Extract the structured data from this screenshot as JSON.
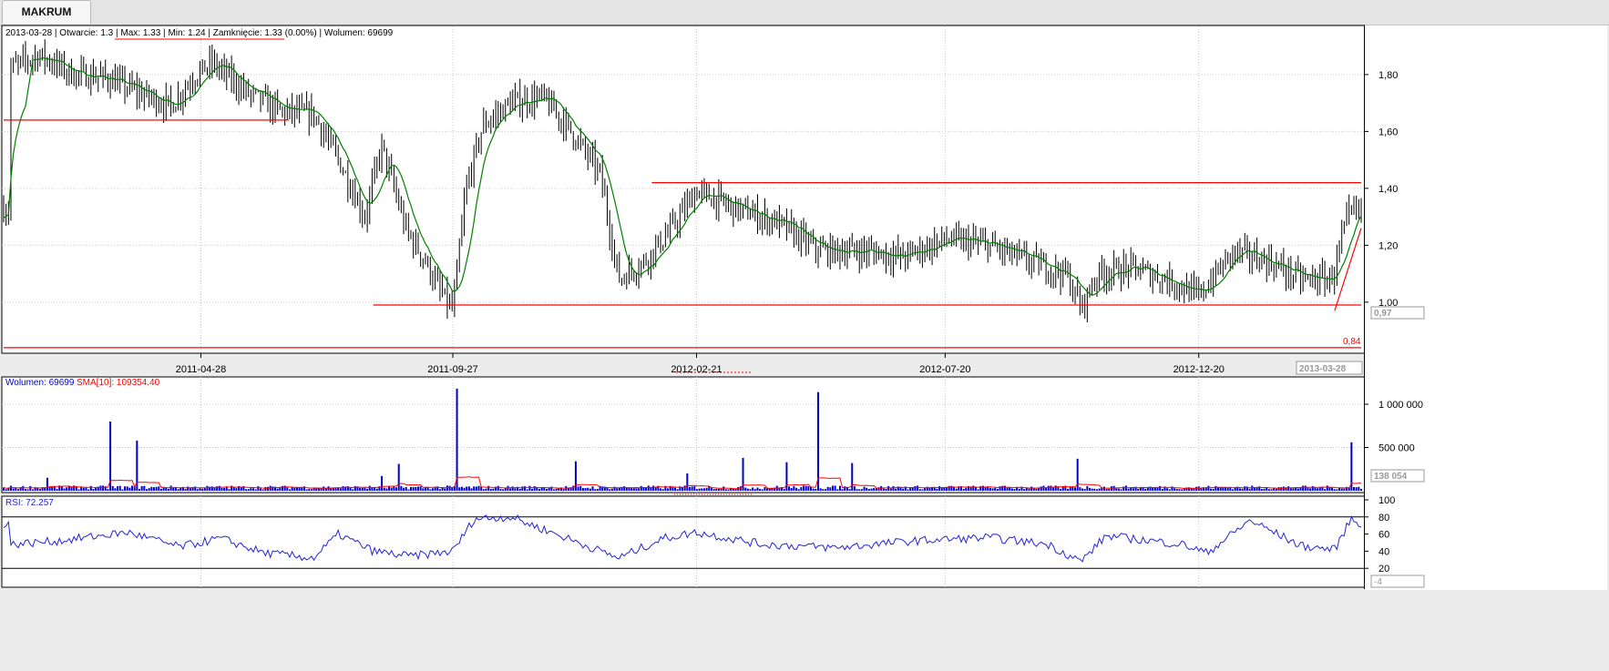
{
  "app": {
    "tab_label": "MAKRUM"
  },
  "colors": {
    "price_bars": "#000000",
    "moving_average": "#008000",
    "trendlines": "#ff0000",
    "volume": "#0000cc",
    "volume_sma": "#ff0000",
    "rsi": "#2222dd",
    "grid": "#c8c8c8",
    "panel_bg": "#ffffff"
  },
  "price_panel": {
    "info_line": "2013-03-28 | Otwarcie: 1.3 | Max: 1.33 | Min: 1.24 | Zamknięcie: 1.33 (0.00%)  | Wolumen: 69699",
    "min_label": "0,84",
    "last_value_badge": "0,97",
    "date_badge": "2013-03-28"
  },
  "volume_panel": {
    "legend_volume": "Wolumen: 69699",
    "legend_sma": "SMA[10]: 109354.40",
    "last_value_badge": "138 054"
  },
  "rsi_panel": {
    "legend": "RSI: 72.257",
    "last_value_badge": "-4"
  },
  "chart_data": [
    {
      "type": "candlestick-ohlc",
      "title": "",
      "x_tick_labels": [
        "2011-04-28",
        "2011-09-27",
        "2012-02-21",
        "2012-07-20",
        "2012-12-20"
      ],
      "x_range": [
        "2010-12-30",
        "2013-03-28"
      ],
      "y_ticks": [
        1.0,
        1.2,
        1.4,
        1.6,
        1.8
      ],
      "y_tick_labels": [
        "1,00",
        "1,20",
        "1,40",
        "1,60",
        "1,80"
      ],
      "ylim": [
        0.83,
        1.95
      ],
      "grid": true,
      "series_close_approx": [
        [
          "2011-01-03",
          1.82
        ],
        [
          "2011-01-20",
          1.87
        ],
        [
          "2011-02-10",
          1.8
        ],
        [
          "2011-03-01",
          1.79
        ],
        [
          "2011-03-20",
          1.74
        ],
        [
          "2011-04-10",
          1.69
        ],
        [
          "2011-04-25",
          1.8
        ],
        [
          "2011-05-05",
          1.84
        ],
        [
          "2011-05-25",
          1.74
        ],
        [
          "2011-06-15",
          1.67
        ],
        [
          "2011-07-05",
          1.66
        ],
        [
          "2011-07-20",
          1.5
        ],
        [
          "2011-08-05",
          1.3
        ],
        [
          "2011-08-15",
          1.55
        ],
        [
          "2011-08-30",
          1.25
        ],
        [
          "2011-09-10",
          1.15
        ],
        [
          "2011-09-18",
          1.05
        ],
        [
          "2011-09-27",
          0.97
        ],
        [
          "2011-10-05",
          1.4
        ],
        [
          "2011-10-15",
          1.62
        ],
        [
          "2011-11-01",
          1.7
        ],
        [
          "2011-11-20",
          1.72
        ],
        [
          "2011-12-05",
          1.62
        ],
        [
          "2011-12-25",
          1.45
        ],
        [
          "2012-01-05",
          1.08
        ],
        [
          "2012-01-20",
          1.14
        ],
        [
          "2012-02-05",
          1.25
        ],
        [
          "2012-02-21",
          1.39
        ],
        [
          "2012-03-15",
          1.33
        ],
        [
          "2012-04-10",
          1.28
        ],
        [
          "2012-05-05",
          1.18
        ],
        [
          "2012-06-01",
          1.18
        ],
        [
          "2012-06-25",
          1.16
        ],
        [
          "2012-07-20",
          1.22
        ],
        [
          "2012-08-15",
          1.2
        ],
        [
          "2012-09-10",
          1.14
        ],
        [
          "2012-10-01",
          1.1
        ],
        [
          "2012-10-10",
          0.98
        ],
        [
          "2012-10-20",
          1.1
        ],
        [
          "2012-11-10",
          1.12
        ],
        [
          "2012-12-05",
          1.07
        ],
        [
          "2012-12-20",
          1.02
        ],
        [
          "2013-01-10",
          1.18
        ],
        [
          "2013-02-01",
          1.14
        ],
        [
          "2013-02-20",
          1.08
        ],
        [
          "2013-03-10",
          1.08
        ],
        [
          "2013-03-20",
          1.3
        ],
        [
          "2013-03-28",
          1.33
        ]
      ],
      "moving_average_color": "green",
      "trendlines": [
        {
          "from": [
            "2010-12-30",
            1.64
          ],
          "to": [
            "2011-06-20",
            1.64
          ]
        },
        {
          "from": [
            "2011-08-10",
            0.99
          ],
          "to": [
            "2013-03-28",
            0.99
          ]
        },
        {
          "from": [
            "2012-01-25",
            1.42
          ],
          "to": [
            "2013-03-28",
            1.42
          ]
        },
        {
          "from": [
            "2010-12-30",
            0.84
          ],
          "to": [
            "2013-03-28",
            0.84
          ]
        },
        {
          "from": [
            "2013-03-12",
            0.97
          ],
          "to": [
            "2013-03-28",
            1.26
          ]
        }
      ]
    },
    {
      "type": "bar",
      "title": "",
      "y_tick_labels": [
        "500 000",
        "1 000 000"
      ],
      "y_ticks": [
        500000,
        1000000
      ],
      "ylim": [
        0,
        1200000
      ],
      "series": [
        {
          "name": "Wolumen",
          "spikes_approx": [
            [
              "2011-01-25",
              150000
            ],
            [
              "2011-03-05",
              800000
            ],
            [
              "2011-03-20",
              580000
            ],
            [
              "2011-08-15",
              170000
            ],
            [
              "2011-08-25",
              310000
            ],
            [
              "2011-09-30",
              1180000
            ],
            [
              "2011-12-10",
              340000
            ],
            [
              "2012-02-15",
              200000
            ],
            [
              "2012-03-20",
              380000
            ],
            [
              "2012-04-15",
              330000
            ],
            [
              "2012-05-05",
              1140000
            ],
            [
              "2012-05-25",
              320000
            ],
            [
              "2012-10-08",
              370000
            ],
            [
              "2013-03-22",
              560000
            ]
          ]
        },
        {
          "name": "SMA[10]",
          "type": "line"
        }
      ]
    },
    {
      "type": "line",
      "title": "",
      "y_ticks": [
        20,
        40,
        60,
        80,
        100
      ],
      "y_tick_labels": [
        "20",
        "40",
        "60",
        "80",
        "100"
      ],
      "ylim": [
        0,
        100
      ],
      "series": [
        {
          "name": "RSI",
          "values_approx": [
            [
              "2011-01-03",
              48
            ],
            [
              "2011-02-01",
              52
            ],
            [
              "2011-03-15",
              62
            ],
            [
              "2011-04-15",
              45
            ],
            [
              "2011-05-10",
              55
            ],
            [
              "2011-06-05",
              38
            ],
            [
              "2011-07-05",
              32
            ],
            [
              "2011-07-20",
              60
            ],
            [
              "2011-08-10",
              40
            ],
            [
              "2011-09-01",
              34
            ],
            [
              "2011-09-27",
              40
            ],
            [
              "2011-10-10",
              78
            ],
            [
              "2011-11-01",
              80
            ],
            [
              "2011-12-01",
              58
            ],
            [
              "2012-01-05",
              32
            ],
            [
              "2012-02-01",
              55
            ],
            [
              "2012-02-21",
              62
            ],
            [
              "2012-04-01",
              48
            ],
            [
              "2012-05-15",
              44
            ],
            [
              "2012-07-01",
              52
            ],
            [
              "2012-08-15",
              56
            ],
            [
              "2012-09-20",
              48
            ],
            [
              "2012-10-10",
              28
            ],
            [
              "2012-10-25",
              58
            ],
            [
              "2012-12-10",
              48
            ],
            [
              "2012-12-25",
              38
            ],
            [
              "2013-01-20",
              76
            ],
            [
              "2013-02-20",
              46
            ],
            [
              "2013-03-12",
              42
            ],
            [
              "2013-03-22",
              78
            ],
            [
              "2013-03-28",
              72
            ]
          ]
        }
      ],
      "reference_lines": [
        80,
        20
      ]
    }
  ]
}
